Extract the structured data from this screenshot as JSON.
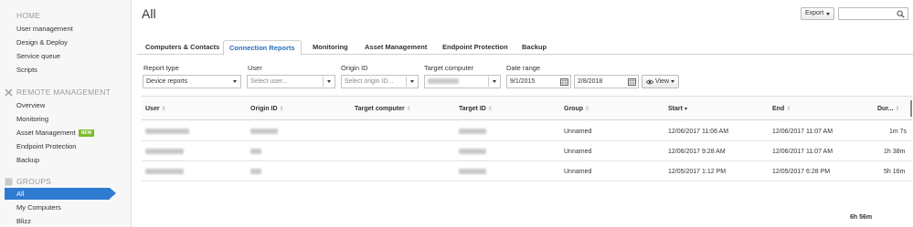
{
  "sidebar": {
    "home": {
      "heading": "HOME",
      "items": [
        "User management",
        "Design & Deploy",
        "Service queue",
        "Scripts"
      ]
    },
    "remote": {
      "heading": "REMOTE MANAGEMENT",
      "items": [
        "Overview",
        "Monitoring",
        "Asset Management",
        "Endpoint Protection",
        "Backup"
      ],
      "new_badge": "NEW"
    },
    "groups": {
      "heading": "GROUPS",
      "active": "All",
      "items": [
        "My Computers",
        "Blizz"
      ]
    }
  },
  "header": {
    "title": "All",
    "export_label": "Export",
    "search_placeholder": ""
  },
  "tabs": [
    "Computers & Contacts",
    "Connection Reports",
    "Monitoring",
    "Asset Management",
    "Endpoint Protection",
    "Backup"
  ],
  "active_tab": "Connection Reports",
  "filters": {
    "report_type": {
      "label": "Report type",
      "value": "Device reports"
    },
    "user": {
      "label": "User",
      "placeholder": "Select user..."
    },
    "origin_id": {
      "label": "Origin ID",
      "placeholder": "Select origin ID..."
    },
    "target_computer": {
      "label": "Target computer"
    },
    "date_range": {
      "label": "Date range",
      "from": "9/1/2015",
      "to": "2/8/2018"
    },
    "view_label": "View"
  },
  "table": {
    "headers": [
      "User",
      "Origin ID",
      "Target computer",
      "Target ID",
      "Group",
      "Start",
      "End",
      "Dur..."
    ],
    "rows": [
      {
        "group": "Unnamed",
        "start": "12/06/2017 11:06 AM",
        "end": "12/06/2017 11:07 AM",
        "duration": "1m 7s"
      },
      {
        "group": "Unnamed",
        "start": "12/06/2017 9:28 AM",
        "end": "12/06/2017 11:07 AM",
        "duration": "1h 38m"
      },
      {
        "group": "Unnamed",
        "start": "12/05/2017 1:12 PM",
        "end": "12/05/2017 6:28 PM",
        "duration": "5h 16m"
      }
    ],
    "total_duration": "6h 56m"
  },
  "colors": {
    "accent": "#2e7bd1",
    "new_badge": "#7cbb2a",
    "active_tab_text": "#2a6fb8"
  }
}
